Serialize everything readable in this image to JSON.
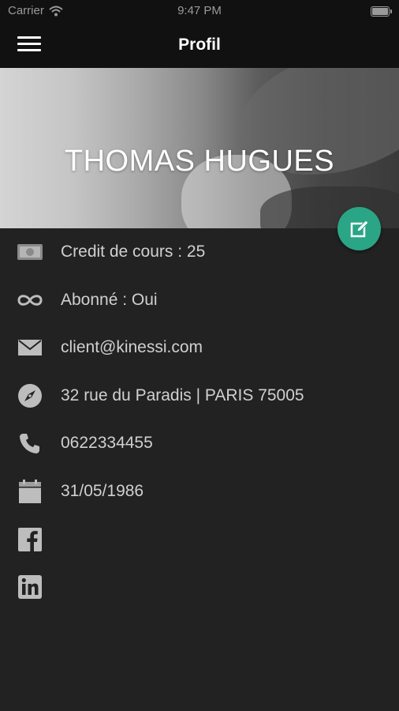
{
  "status_bar": {
    "carrier": "Carrier",
    "time": "9:47 PM"
  },
  "nav": {
    "title": "Profil"
  },
  "profile": {
    "name": "THOMAS HUGUES"
  },
  "rows": [
    {
      "icon": "money-icon",
      "text": "Credit de cours : 25"
    },
    {
      "icon": "infinity-icon",
      "text": "Abonné : Oui"
    },
    {
      "icon": "envelope-icon",
      "text": "client@kinessi.com"
    },
    {
      "icon": "compass-icon",
      "text": "32 rue du Paradis | PARIS 75005"
    },
    {
      "icon": "phone-icon",
      "text": "0622334455"
    },
    {
      "icon": "calendar-icon",
      "text": "31/05/1986"
    },
    {
      "icon": "facebook-icon",
      "text": ""
    },
    {
      "icon": "linkedin-icon",
      "text": ""
    }
  ],
  "colors": {
    "accent": "#2aa585",
    "background": "#222222",
    "bar": "#111111"
  }
}
